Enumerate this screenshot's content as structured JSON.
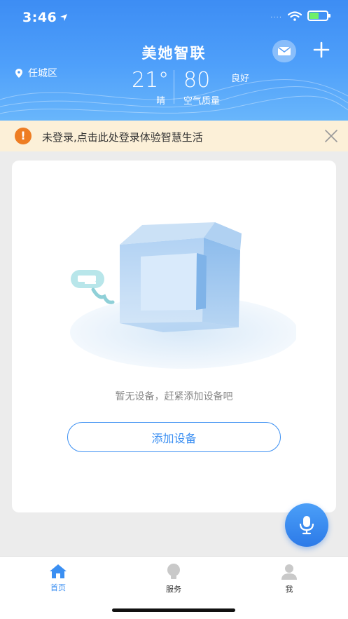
{
  "status_bar": {
    "time": "3:46",
    "signal": "....",
    "battery_level": 0.55
  },
  "header": {
    "title": "美她智联",
    "location": "任城区",
    "temperature": "21°",
    "weather": "晴",
    "aqi_value": "80",
    "aqi_level": "良好",
    "aqi_label": "空气质量"
  },
  "notice": {
    "text": "未登录,点击此处登录体验智慧生活",
    "icon_glyph": "!"
  },
  "main": {
    "empty_text": "暂无设备，赶紧添加设备吧",
    "add_button_label": "添加设备"
  },
  "tabs": [
    {
      "label": "首页",
      "icon": "home-icon"
    },
    {
      "label": "服务",
      "icon": "bulb-icon"
    },
    {
      "label": "我",
      "icon": "user-icon"
    }
  ],
  "colors": {
    "brand": "#3b8ff2",
    "notice_bg": "#fcf0d8",
    "notice_icon": "#ee7d23"
  }
}
